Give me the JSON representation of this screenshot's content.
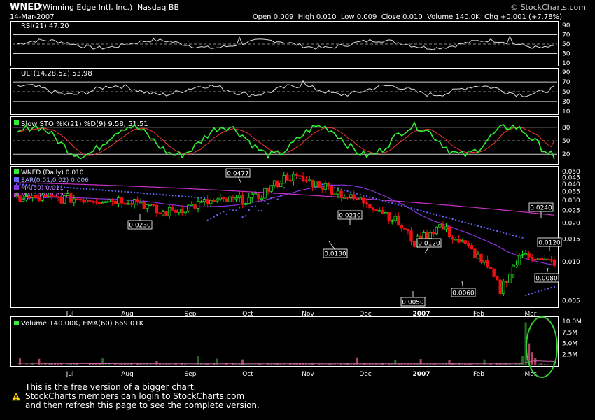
{
  "header": {
    "symbol": "WNED",
    "company": "(Winning Edge Intl, Inc.)",
    "exchange": "Nasdaq BB",
    "date": "14-Mar-2007",
    "quote": "Open 0.009  High 0.010  Low 0.009  Close 0.010  Volume 140.0K  Chg +0.001 (+7.78%)",
    "watermark": "© StockCharts.com"
  },
  "panels": {
    "rsi": {
      "label": "RSI(21) 47.20",
      "ticks": [
        "90",
        "70",
        "50",
        "30",
        "10"
      ]
    },
    "ult": {
      "label": "ULT(14,28,52) 53.98",
      "ticks": [
        "90",
        "70",
        "50",
        "30",
        "10"
      ]
    },
    "sto": {
      "label": "Slow STO %K(21) %D(9) 9.58, 51.51",
      "ticks": [
        "80",
        "50",
        "20"
      ]
    },
    "price": {
      "legend": [
        "WNED (Daily) 0.010",
        "SAR(0.01,0.02) 0.006",
        "MA(50) 0.011",
        "MA(200) 0.023"
      ],
      "ticks": [
        "0.050",
        "0.045",
        "0.040",
        "0.035",
        "0.030",
        "0.025",
        "0.020",
        "0.015",
        "0.010",
        "0.005"
      ]
    },
    "volume": {
      "label": "Volume 140.00K, EMA(60) 669.01K",
      "ticks": [
        "10.0M",
        "7.5M",
        "5.0M",
        "2.5M"
      ]
    }
  },
  "x_axis": [
    "Jul",
    "Aug",
    "Sep",
    "Oct",
    "Nov",
    "Dec",
    "2007",
    "Feb",
    "Mar"
  ],
  "annotations": [
    "0.0477",
    "0.0230",
    "0.0210",
    "0.0130",
    "0.0120",
    "0.0050",
    "0.0060",
    "0.0240",
    "0.0120",
    "0.0080"
  ],
  "footer": {
    "line1": "This is the free version of a bigger chart.",
    "line2": "StockCharts members can login to StockCharts.com",
    "line3": "and then refresh this page to see the complete version."
  },
  "colors": {
    "up": "#22dd22",
    "down": "#ee1111",
    "ma50": "#8833dd",
    "ma200": "#cc33cc",
    "sar": "#6666ff",
    "sto_k": "#33ee33",
    "sto_d": "#ee3333",
    "highlight": "#33cc33"
  },
  "chart_data": {
    "type": "line",
    "title": "WNED (Winning Edge Intl, Inc.) Nasdaq BB",
    "x": [
      "Jul",
      "Aug",
      "Sep",
      "Oct",
      "Nov",
      "Dec",
      "2007",
      "Feb",
      "Mar"
    ],
    "ylim": [
      0.005,
      0.05
    ],
    "log_scale": true,
    "series": [
      {
        "name": "WNED (Daily)",
        "values": [
          0.031,
          0.03,
          0.031,
          0.045,
          0.032,
          0.015,
          0.008,
          0.011,
          0.01
        ]
      },
      {
        "name": "MA(50)",
        "values": [
          0.03,
          0.03,
          0.031,
          0.034,
          0.031,
          0.02,
          0.013,
          0.011,
          0.011
        ]
      },
      {
        "name": "MA(200)",
        "values": [
          0.04,
          0.038,
          0.036,
          0.035,
          0.033,
          0.03,
          0.027,
          0.025,
          0.023
        ]
      }
    ],
    "volume_ticks": [
      "10.0M",
      "7.5M",
      "5.0M",
      "2.5M"
    ]
  }
}
